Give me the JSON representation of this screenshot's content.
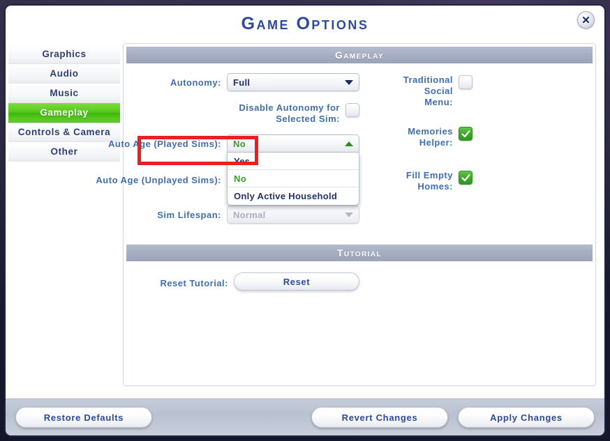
{
  "window": {
    "title": "Game Options",
    "close_icon": "close-icon"
  },
  "sidebar": {
    "items": [
      {
        "label": "Graphics",
        "active": false
      },
      {
        "label": "Audio",
        "active": false
      },
      {
        "label": "Music",
        "active": false
      },
      {
        "label": "Gameplay",
        "active": true
      },
      {
        "label": "Controls & Camera",
        "active": false
      },
      {
        "label": "Other",
        "active": false
      }
    ],
    "active_label": "Gameplay"
  },
  "sections": {
    "gameplay_header": "Gameplay",
    "tutorial_header": "Tutorial"
  },
  "gameplay": {
    "left": {
      "autonomy": {
        "label": "Autonomy:",
        "value": "Full",
        "caret": "chevron-down-icon"
      },
      "disable_autonomy": {
        "label": "Disable Autonomy for\nSelected Sim:",
        "checked": false
      },
      "auto_age_played": {
        "label": "Auto Age (Played Sims):",
        "value": "No",
        "caret": "chevron-up-icon",
        "open": true,
        "options": [
          {
            "label": "Yes",
            "selected": false
          },
          {
            "label": "No",
            "selected": true
          },
          {
            "label": "Only Active Household",
            "selected": false
          }
        ]
      },
      "auto_age_unplayed": {
        "label": "Auto Age (Unplayed Sims):"
      },
      "sim_lifespan": {
        "label": "Sim Lifespan:",
        "value": "Normal",
        "disabled": true,
        "caret": "chevron-down-icon"
      }
    },
    "right": [
      {
        "label": "Traditional Social\nMenu:",
        "checked": false
      },
      {
        "label": "Memories Helper:",
        "checked": true
      },
      {
        "label": "Fill Empty Homes:",
        "checked": true
      }
    ]
  },
  "tutorial": {
    "label": "Reset Tutorial:",
    "button": "Reset"
  },
  "footer": {
    "restore_defaults": "Restore Defaults",
    "revert_changes": "Revert Changes",
    "apply_changes": "Apply Changes"
  },
  "annotation": {
    "highlight_target": "Auto Age (Played Sims):",
    "color": "#e82020"
  },
  "colors": {
    "accent_green": "#3fb80d",
    "title_blue": "#2b4a9b",
    "label_blue": "#3f6fb0",
    "section_bar": "#a5aec2",
    "highlight_red": "#e82020"
  }
}
